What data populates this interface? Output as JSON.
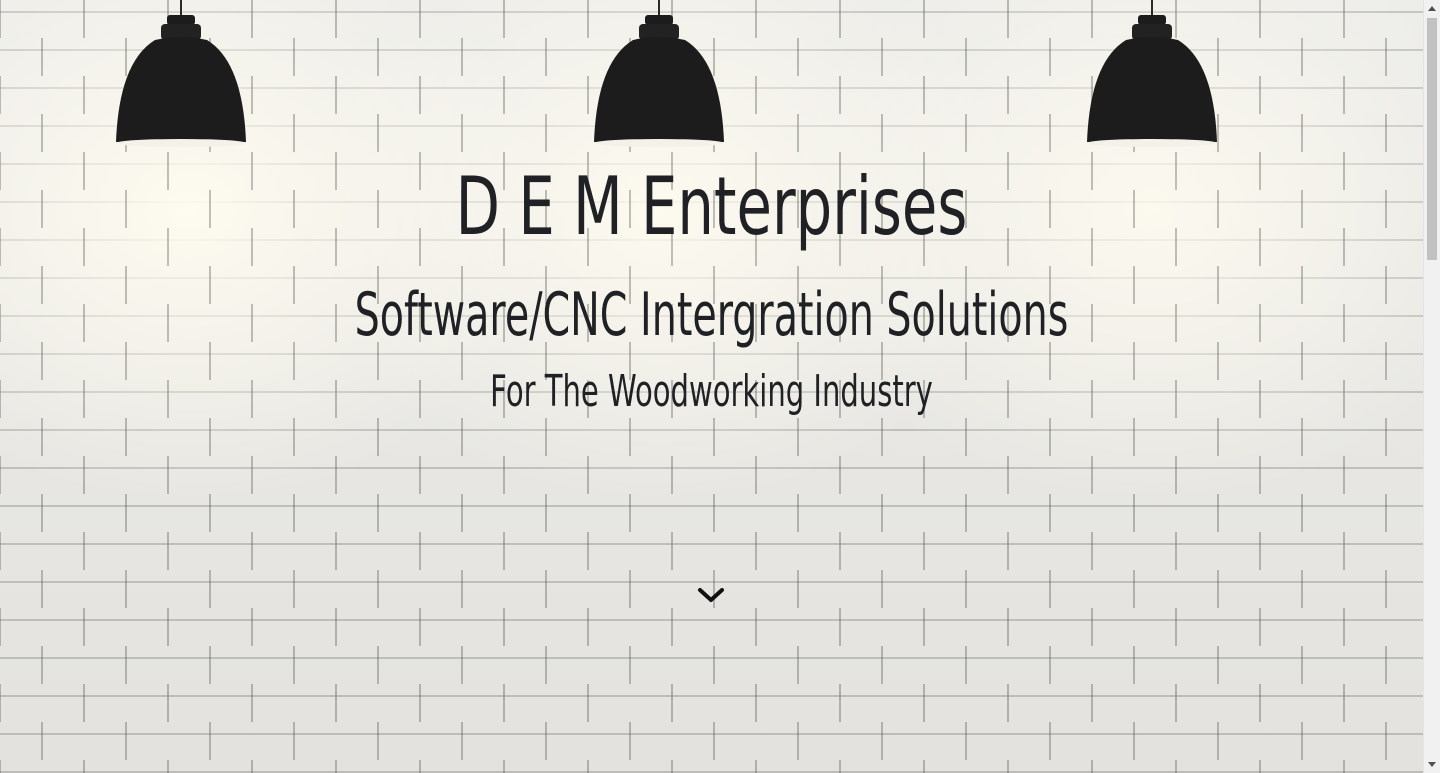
{
  "hero": {
    "title": "D E M Enterprises",
    "tagline": "Software/CNC Intergration Solutions",
    "sub_tagline": "For The Woodworking Industry",
    "scroll_icon": "chevron-down-icon"
  },
  "colors": {
    "text": "#1f2125",
    "lamp": "#1c1c1c",
    "wall": "#e9e8e4",
    "scrollbar_track": "#f1f1f1",
    "scrollbar_thumb": "#c1c1c1"
  }
}
